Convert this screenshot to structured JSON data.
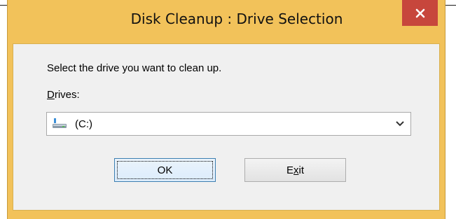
{
  "window": {
    "title": "Disk Cleanup : Drive Selection"
  },
  "dialog": {
    "prompt": "Select the drive you want to clean up.",
    "drives_label_mnemonic": "D",
    "drives_label_rest": "rives:",
    "selected_drive": "(C:)",
    "ok_label": "OK",
    "exit_label_pre": "E",
    "exit_label_mnemonic": "x",
    "exit_label_post": "it"
  },
  "icons": {
    "close": "close-icon",
    "drive": "hard-drive-icon",
    "dropdown": "chevron-down-icon"
  },
  "colors": {
    "title_bar": "#f2c25a",
    "close_button": "#c7463c",
    "dialog_bg": "#f0f0f0"
  }
}
